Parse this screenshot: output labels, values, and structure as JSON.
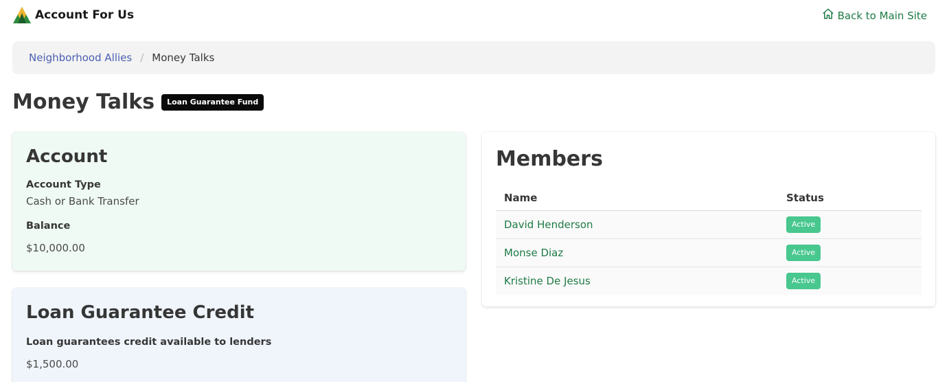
{
  "navbar": {
    "brand_name": "Account For Us",
    "back_label": "Back to Main Site",
    "accent_color": "#1f7a45"
  },
  "breadcrumb": {
    "parent": "Neighborhood Allies",
    "separator": "/",
    "current": "Money Talks"
  },
  "page": {
    "title": "Money Talks",
    "tag": "Loan Guarantee Fund"
  },
  "account": {
    "title": "Account",
    "type_label": "Account Type",
    "type_value": "Cash or Bank Transfer",
    "balance_label": "Balance",
    "balance_value": "$10,000.00"
  },
  "loan": {
    "title": "Loan Guarantee Credit",
    "credit_label": "Loan guarantees credit available to lenders",
    "credit_value": "$1,500.00"
  },
  "members": {
    "title": "Members",
    "columns": [
      "Name",
      "Status"
    ],
    "rows": [
      {
        "name": "David Henderson",
        "status": "Active"
      },
      {
        "name": "Monse Diaz",
        "status": "Active"
      },
      {
        "name": "Kristine De Jesus",
        "status": "Active"
      }
    ],
    "status_color": "#48c78e"
  },
  "icons": {
    "brand": "logo-mountains-icon",
    "back": "home-icon"
  }
}
